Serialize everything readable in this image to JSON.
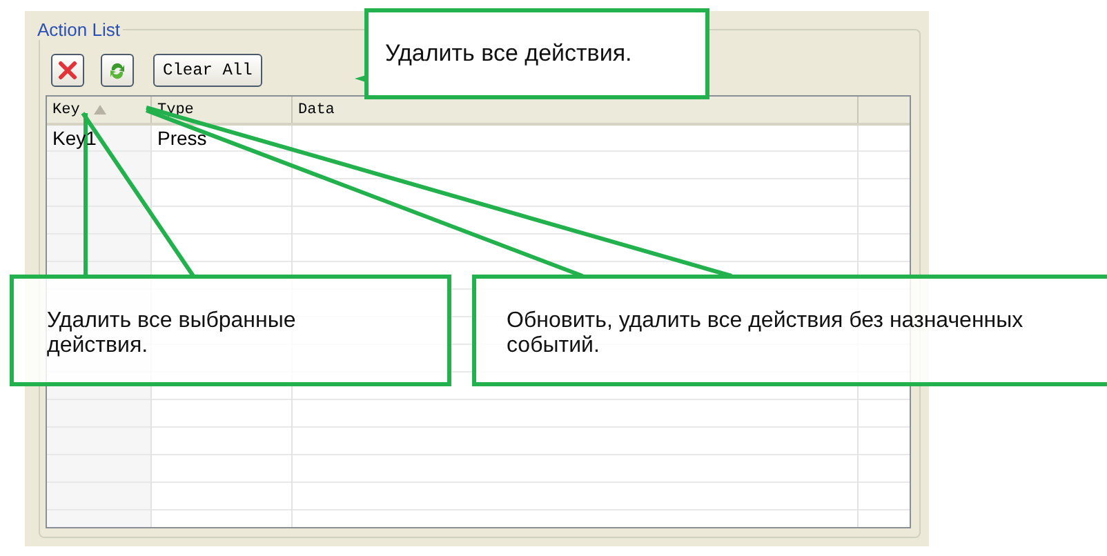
{
  "group_title": "Action List",
  "toolbar": {
    "clear_button": "Clear All"
  },
  "table": {
    "columns": [
      "Key",
      "Type",
      "Data"
    ],
    "rows": [
      {
        "key": "Key1",
        "type": "Press",
        "data": ""
      }
    ]
  },
  "callouts": [
    {
      "text": "Удалить все действия."
    },
    {
      "text": "Удалить все выбранные действия."
    },
    {
      "text": "Обновить, удалить все действия без назначенных событий."
    }
  ]
}
